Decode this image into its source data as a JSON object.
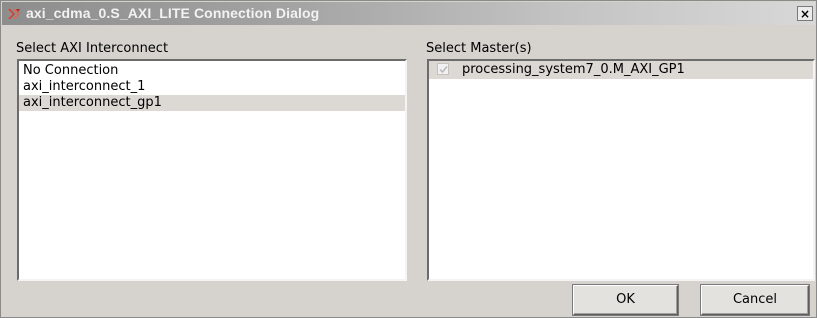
{
  "window": {
    "title": "axi_cdma_0.S_AXI_LITE Connection Dialog",
    "close_label": "×"
  },
  "left_panel": {
    "label": "Select AXI Interconnect",
    "items": [
      {
        "label": "No Connection",
        "selected": false
      },
      {
        "label": "axi_interconnect_1",
        "selected": false
      },
      {
        "label": "axi_interconnect_gp1",
        "selected": true
      }
    ]
  },
  "right_panel": {
    "label": "Select Master(s)",
    "masters": [
      {
        "label": "processing_system7_0.M_AXI_GP1",
        "checked": true
      }
    ]
  },
  "buttons": {
    "ok_label": "OK",
    "cancel_label": "Cancel"
  },
  "icons": {
    "app_icon": "xilinx-logo-icon",
    "close_icon": "close-icon",
    "check_icon": "check-icon"
  },
  "colors": {
    "titlebar_start": "#8d8d8d",
    "titlebar_end": "#d8d8d8",
    "dialog_bg": "#d6d3ce",
    "selected_bg": "#dcd8d4",
    "logo_red": "#d83a2a"
  }
}
